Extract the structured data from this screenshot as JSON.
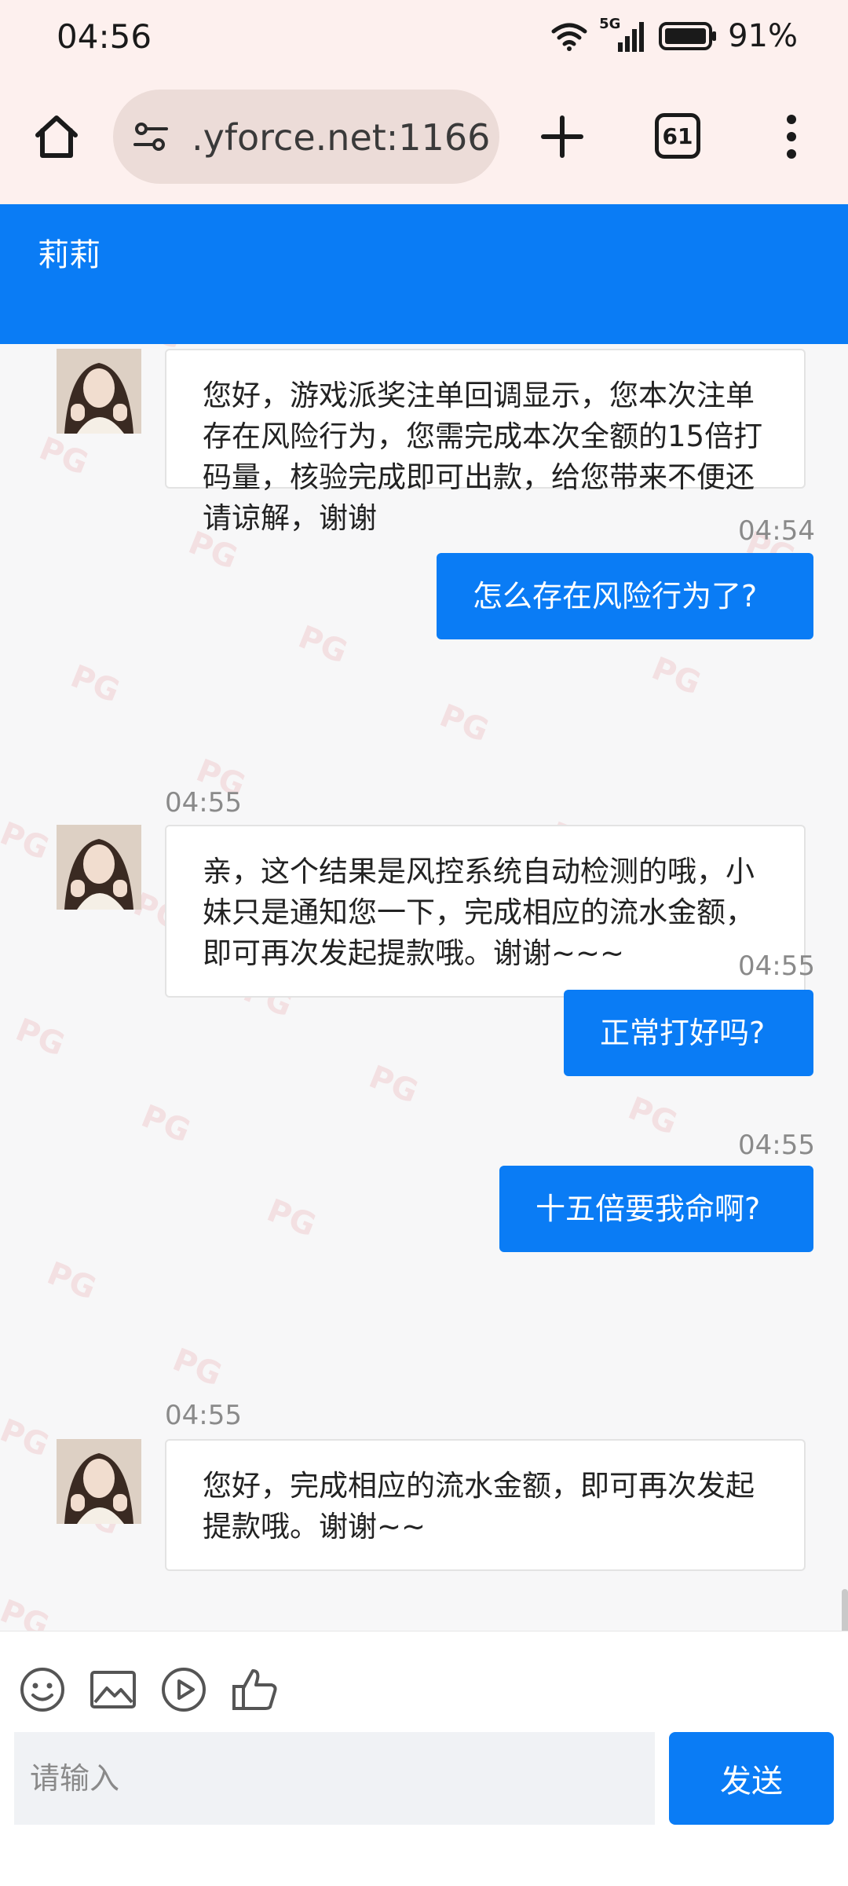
{
  "status_bar": {
    "time": "04:56",
    "network": "5G",
    "battery": "91%"
  },
  "browser": {
    "url": ".yforce.net:1166",
    "tab_count": "61"
  },
  "chat": {
    "title": "莉莉",
    "watermark": "PG",
    "messages": [
      {
        "from": "agent",
        "text": "您好，游戏派奖注单回调显示，您本次注单存在风险行为，您需完成本次全额的15倍打码量，核验完成即可出款，给您带来不便还请谅解，谢谢"
      },
      {
        "from": "user",
        "time": "04:54",
        "text": "怎么存在风险行为了?"
      },
      {
        "from": "agent",
        "time": "04:55",
        "text": "亲，这个结果是风控系统自动检测的哦，小妹只是通知您一下，完成相应的流水金额，即可再次发起提款哦。谢谢~~~"
      },
      {
        "from": "user",
        "time": "04:55",
        "text": "正常打好吗?"
      },
      {
        "from": "user",
        "time": "04:55",
        "text": "十五倍要我命啊?"
      },
      {
        "from": "agent",
        "time": "04:55",
        "text": "您好，完成相应的流水金额，即可再次发起提款哦。谢谢~~"
      }
    ]
  },
  "composer": {
    "tools": [
      "emoji-icon",
      "image-icon",
      "video-icon",
      "thumbs-up-icon"
    ],
    "placeholder": "请输入",
    "send_label": "发送"
  }
}
